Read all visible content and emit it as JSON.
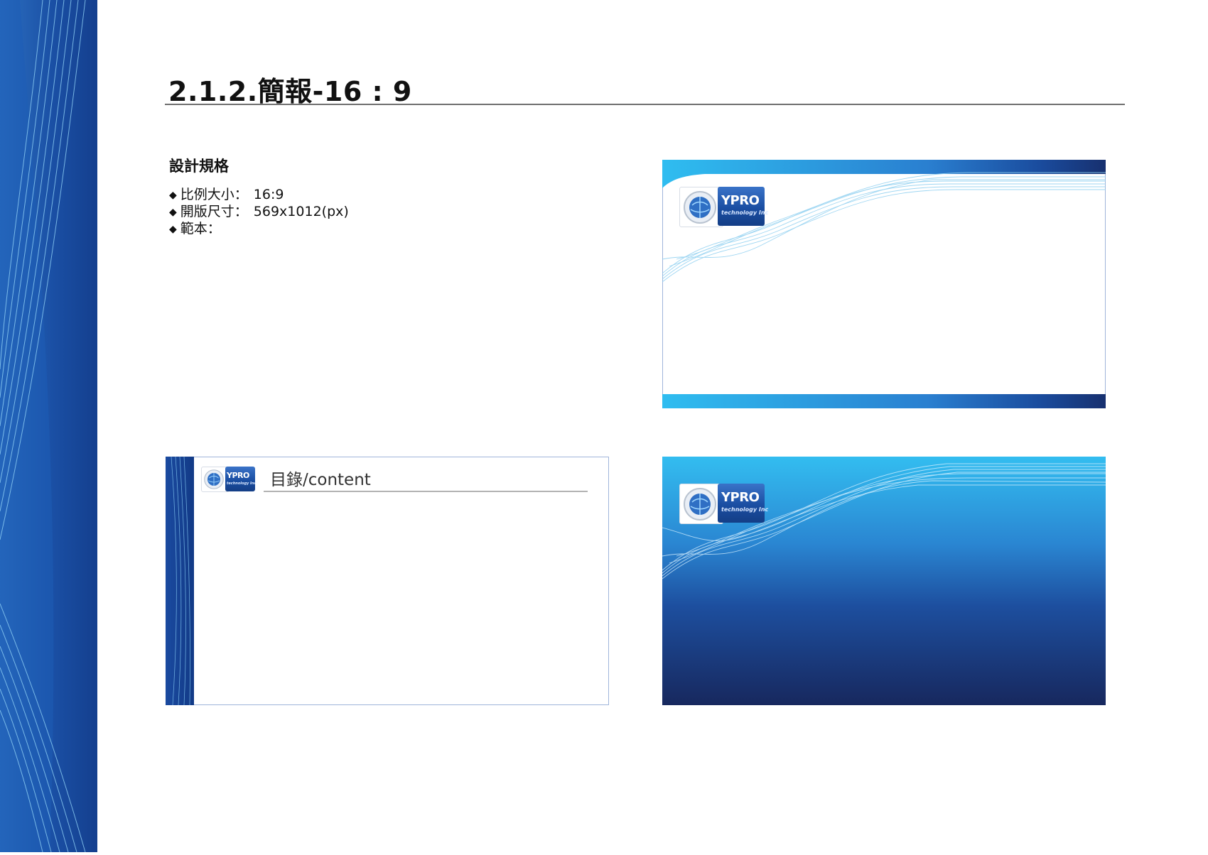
{
  "page": {
    "title": "2.1.2.簡報-16 : 9"
  },
  "spec": {
    "heading": "設計規格",
    "items": [
      {
        "label": "比例大小：",
        "value": "16:9"
      },
      {
        "label": "開版尺寸：",
        "value": "569x1012(px)"
      },
      {
        "label": "範本：",
        "value": ""
      }
    ],
    "bullet": "◆"
  },
  "templates": {
    "logo_word": "YPRO",
    "logo_sub": "technology Inc",
    "content_title": "目錄/content"
  },
  "colors": {
    "brand_dark": "#17307a",
    "brand_mid": "#1f5fb4",
    "brand_light": "#2fb8ee",
    "rule": "#6f6f6f"
  },
  "icons": [
    "globe-logo-icon",
    "wave-lines-decoration"
  ]
}
